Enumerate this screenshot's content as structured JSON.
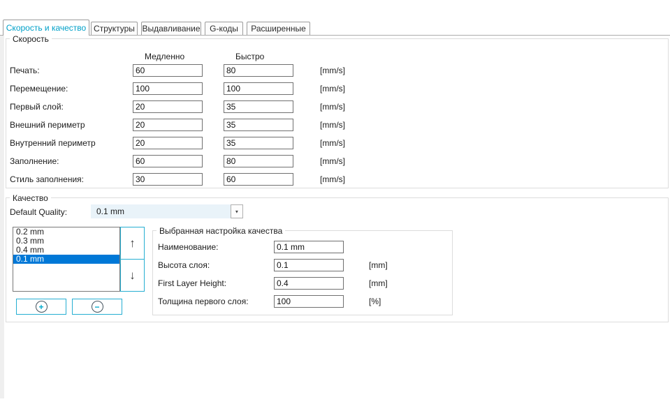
{
  "tabs": [
    {
      "label": "Скорость и качество"
    },
    {
      "label": "Структуры"
    },
    {
      "label": "Выдавливание"
    },
    {
      "label": "G-коды"
    },
    {
      "label": "Расширенные"
    }
  ],
  "speed": {
    "title": "Скорость",
    "columns": {
      "slow": "Медленно",
      "fast": "Быстро"
    },
    "unit": "[mm/s]",
    "rows": [
      {
        "label": "Печать:",
        "slow": "60",
        "fast": "80"
      },
      {
        "label": "Перемещение:",
        "slow": "100",
        "fast": "100"
      },
      {
        "label": "Первый слой:",
        "slow": "20",
        "fast": "35"
      },
      {
        "label": "Внешний периметр",
        "slow": "20",
        "fast": "35"
      },
      {
        "label": "Внутренний периметр",
        "slow": "20",
        "fast": "35"
      },
      {
        "label": "Заполнение:",
        "slow": "60",
        "fast": "80"
      },
      {
        "label": "Стиль заполнения:",
        "slow": "30",
        "fast": "60"
      }
    ]
  },
  "quality": {
    "title": "Качество",
    "default_label": "Default Quality:",
    "default_value": "0.1 mm",
    "list": [
      "0.2 mm",
      "0.3 mm",
      "0.4 mm",
      "0.1 mm"
    ],
    "selected_value": "0.1 mm",
    "glyphs": {
      "up": "↑",
      "down": "↓",
      "add": "+",
      "remove": "−",
      "dropdown": "▼"
    },
    "selected": {
      "title": "Выбранная настройка качества",
      "rows": [
        {
          "label": "Наименование:",
          "value": "0.1 mm",
          "unit": ""
        },
        {
          "label": "Высота слоя:",
          "value": "0.1",
          "unit": "[mm]"
        },
        {
          "label": "First Layer Height:",
          "value": "0.4",
          "unit": "[mm]"
        },
        {
          "label": "Толщина первого слоя:",
          "value": "100",
          "unit": "[%]"
        }
      ]
    }
  },
  "colors": {
    "accent_cyan": "#25aed2",
    "tab_active_text": "#00a0c8",
    "selection_blue": "#0078d7",
    "combo_bg": "#e9f3f9"
  }
}
